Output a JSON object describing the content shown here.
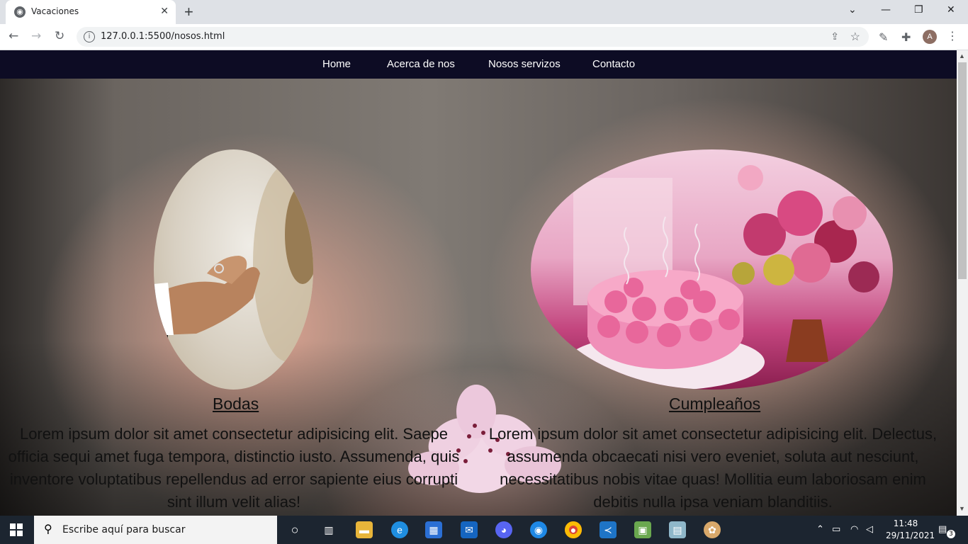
{
  "browser": {
    "tab_title": "Vacaciones",
    "tab_close": "✕",
    "new_tab": "+",
    "url": "127.0.0.1:5500/nosos.html",
    "window_controls": {
      "dropdown": "⌄",
      "minimize": "—",
      "restore": "❐",
      "close": "✕"
    },
    "nav": {
      "back": "←",
      "forward": "→",
      "reload": "↻"
    },
    "profile_initial": "A"
  },
  "site": {
    "nav_items": [
      "Home",
      "Acerca de nos",
      "Nosos servizos",
      "Contacto"
    ],
    "services": [
      {
        "caption": "Bodas",
        "text": "Lorem ipsum dolor sit amet consectetur adipisicing elit. Saepe officia sequi amet fuga tempora, distinctio iusto. Assumenda, quis inventore voluptatibus repellendus ad error sapiente eius corrupti sint illum velit alias!"
      },
      {
        "caption": "Cumpleaños",
        "text": "Lorem ipsum dolor sit amet consectetur adipisicing elit. Delectus, assumenda obcaecati nisi vero eveniet, soluta aut nesciunt, necessitatibus nobis vitae quas! Mollitia eum laboriosam enim debitis nulla ipsa veniam blanditiis."
      }
    ]
  },
  "taskbar": {
    "search_placeholder": "Escribe aquí para buscar",
    "time": "11:48",
    "date": "29/11/2021",
    "notification_count": "3"
  },
  "colors": {
    "navbar": "#0d0c24",
    "taskbar": "#1c2530"
  }
}
